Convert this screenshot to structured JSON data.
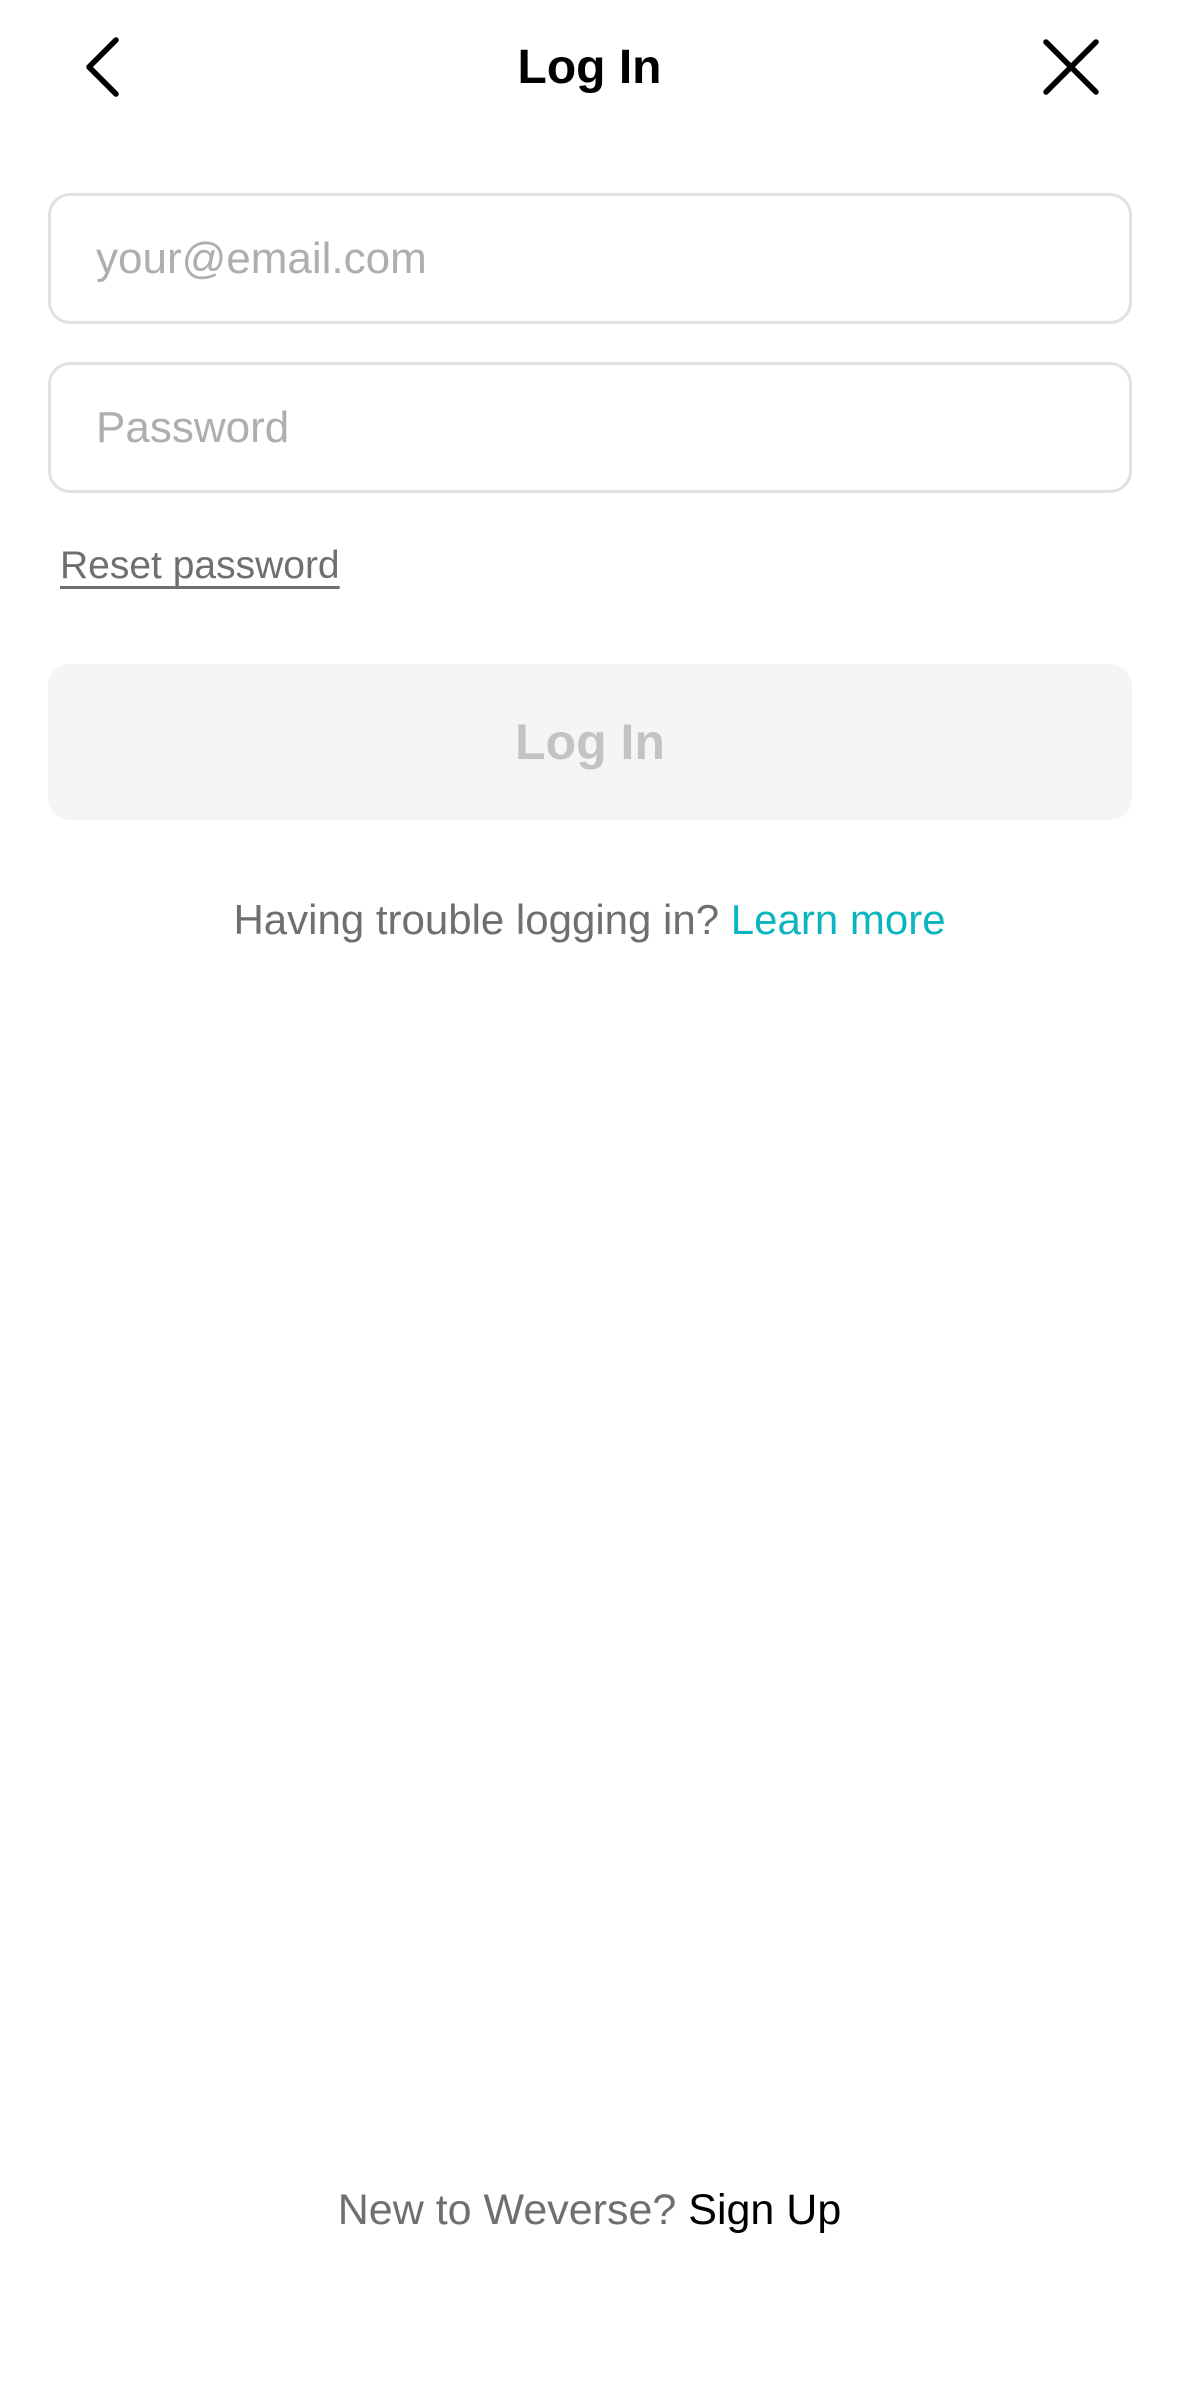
{
  "header": {
    "title": "Log In",
    "back_icon": "chevron-left-icon",
    "close_icon": "close-icon"
  },
  "form": {
    "email": {
      "value": "",
      "placeholder": "your@email.com"
    },
    "password": {
      "value": "",
      "placeholder": "Password"
    },
    "reset_password_label": "Reset password",
    "login_button_label": "Log In",
    "login_button_enabled": false
  },
  "help": {
    "trouble_text": "Having trouble logging in?",
    "learn_more_label": "Learn more"
  },
  "footer": {
    "prompt": "New to Weverse?",
    "signup_label": "Sign Up"
  },
  "colors": {
    "accent": "#0bb5c0",
    "field_border": "#e1e1e1",
    "placeholder": "#aeaeae",
    "disabled_button_bg": "#f5f5f5",
    "disabled_button_text": "#c3c3c3",
    "secondary_text": "#6f6f6f"
  }
}
